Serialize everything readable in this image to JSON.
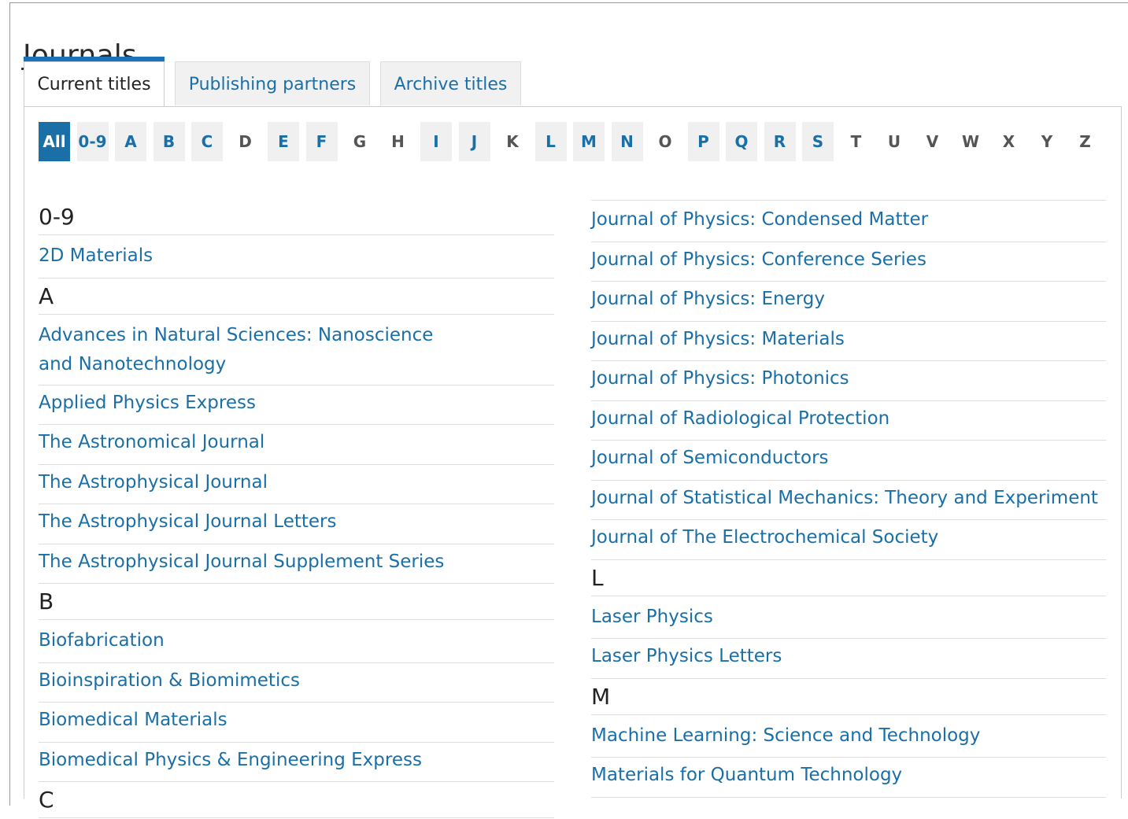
{
  "page": {
    "title": "Journals"
  },
  "tabs": [
    {
      "label": "Current titles",
      "active": true
    },
    {
      "label": "Publishing partners",
      "active": false
    },
    {
      "label": "Archive titles",
      "active": false
    }
  ],
  "alphabet": [
    {
      "label": "All",
      "state": "active"
    },
    {
      "label": "0-9",
      "state": "has"
    },
    {
      "label": "A",
      "state": "has"
    },
    {
      "label": "B",
      "state": "has"
    },
    {
      "label": "C",
      "state": "has"
    },
    {
      "label": "D",
      "state": "none"
    },
    {
      "label": "E",
      "state": "has"
    },
    {
      "label": "F",
      "state": "has"
    },
    {
      "label": "G",
      "state": "none"
    },
    {
      "label": "H",
      "state": "none"
    },
    {
      "label": "I",
      "state": "has"
    },
    {
      "label": "J",
      "state": "has"
    },
    {
      "label": "K",
      "state": "none"
    },
    {
      "label": "L",
      "state": "has"
    },
    {
      "label": "M",
      "state": "has"
    },
    {
      "label": "N",
      "state": "has"
    },
    {
      "label": "O",
      "state": "none"
    },
    {
      "label": "P",
      "state": "has"
    },
    {
      "label": "Q",
      "state": "has"
    },
    {
      "label": "R",
      "state": "has"
    },
    {
      "label": "S",
      "state": "has"
    },
    {
      "label": "T",
      "state": "none"
    },
    {
      "label": "U",
      "state": "none"
    },
    {
      "label": "V",
      "state": "none"
    },
    {
      "label": "W",
      "state": "none"
    },
    {
      "label": "X",
      "state": "none"
    },
    {
      "label": "Y",
      "state": "none"
    },
    {
      "label": "Z",
      "state": "none"
    }
  ],
  "left_column": [
    {
      "type": "head",
      "text": "0-9"
    },
    {
      "type": "item",
      "text": "2D Materials"
    },
    {
      "type": "head",
      "text": "A"
    },
    {
      "type": "item",
      "text": "Advances in Natural Sciences: Nanoscience and Nanotechnology",
      "lines": 2
    },
    {
      "type": "item",
      "text": "Applied Physics Express"
    },
    {
      "type": "item",
      "text": "The Astronomical Journal"
    },
    {
      "type": "item",
      "text": "The Astrophysical Journal"
    },
    {
      "type": "item",
      "text": "The Astrophysical Journal Letters"
    },
    {
      "type": "item",
      "text": "The Astrophysical Journal Supplement Series"
    },
    {
      "type": "head",
      "text": "B"
    },
    {
      "type": "item",
      "text": "Biofabrication"
    },
    {
      "type": "item",
      "text": "Bioinspiration & Biomimetics"
    },
    {
      "type": "item",
      "text": "Biomedical Materials"
    },
    {
      "type": "item",
      "text": "Biomedical Physics & Engineering Express"
    },
    {
      "type": "head",
      "text": "C"
    }
  ],
  "right_column": [
    {
      "type": "item",
      "text": "Journal of Physics: Condensed Matter"
    },
    {
      "type": "item",
      "text": "Journal of Physics: Conference Series"
    },
    {
      "type": "item",
      "text": "Journal of Physics: Energy"
    },
    {
      "type": "item",
      "text": "Journal of Physics: Materials"
    },
    {
      "type": "item",
      "text": "Journal of Physics: Photonics"
    },
    {
      "type": "item",
      "text": "Journal of Radiological Protection"
    },
    {
      "type": "item",
      "text": "Journal of Semiconductors"
    },
    {
      "type": "item",
      "text": "Journal of Statistical Mechanics: Theory and Experiment"
    },
    {
      "type": "item",
      "text": "Journal of The Electrochemical Society"
    },
    {
      "type": "head",
      "text": "L"
    },
    {
      "type": "item",
      "text": "Laser Physics"
    },
    {
      "type": "item",
      "text": "Laser Physics Letters"
    },
    {
      "type": "head",
      "text": "M"
    },
    {
      "type": "item",
      "text": "Machine Learning: Science and Technology"
    },
    {
      "type": "item",
      "text": "Materials for Quantum Technology"
    }
  ]
}
